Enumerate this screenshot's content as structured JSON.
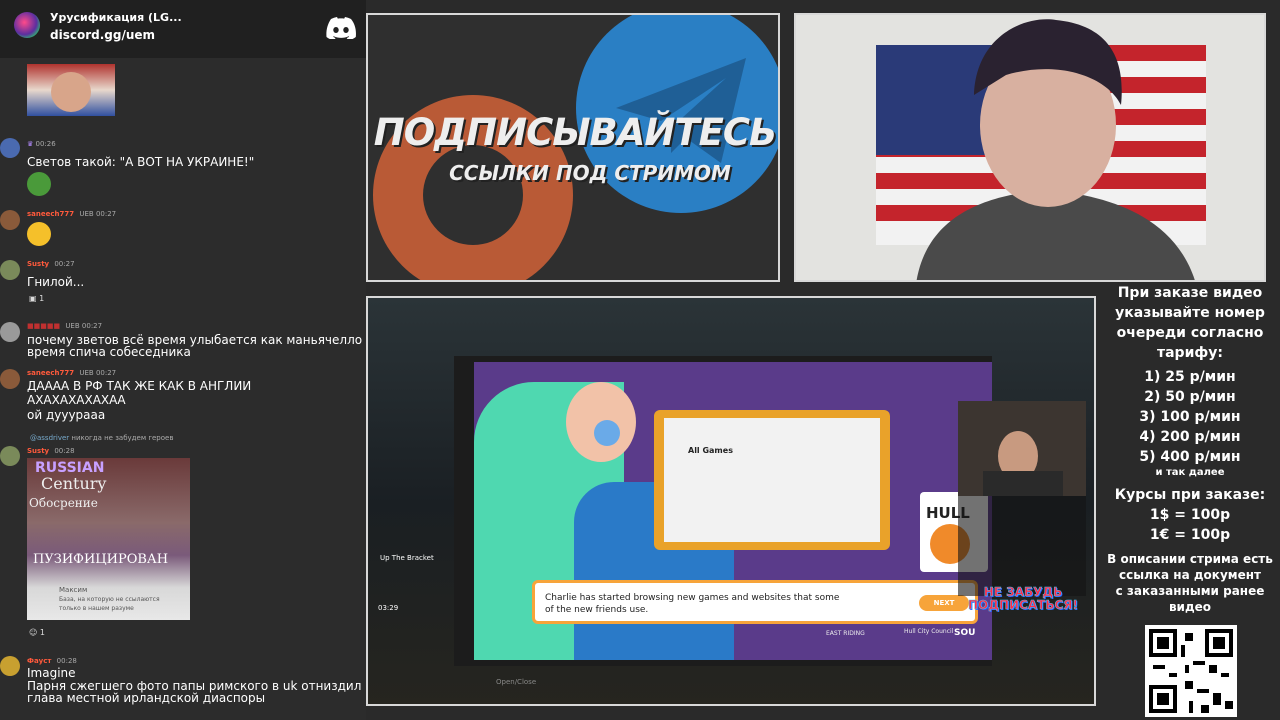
{
  "discord": {
    "server_name": "Урусификация (LG...",
    "link": "discord.gg/uem",
    "icon": "discord-icon"
  },
  "chat": {
    "messages": [
      {
        "time": "00:26",
        "text": "Светов такой: \"А ВОТ НА УКРАИНЕ!\""
      },
      {
        "user": "saneech777",
        "badge": "UEB",
        "time": "00:27"
      },
      {
        "user": "Susty",
        "time": "00:27",
        "text": "Гнилой...",
        "reaction_count": "1"
      },
      {
        "badge": "UEB",
        "time": "00:27",
        "text": "почему зветов всё время улыбается как маньячелло во",
        "text2": "время спича собеседника"
      },
      {
        "user": "saneech777",
        "badge": "UEB",
        "time": "00:27",
        "text": "ДАААА В РФ ТАК ЖЕ КАК В АНГЛИИ",
        "text2": "АХАХАХАХАХАА",
        "text3": "ой дууурааа"
      },
      {
        "reply_user": "@assdriver",
        "reply_text": "никогда не забудем героев"
      },
      {
        "user": "Susty",
        "time": "00:28",
        "image_lines": [
          "RUSSIAN",
          "Century",
          "Обосрение",
          "ПУЗИФИЦИРОВАН",
          "Максим",
          "База, на которую не ссылаются",
          "только в нашем разуме"
        ],
        "reaction_count": "1"
      },
      {
        "user": "Фауст",
        "time": "00:28",
        "text": "Imagine",
        "text2": "Парня сжегшего фото папы римского в uk отниздил",
        "text3": "глава местной ирландской диаспоры"
      }
    ]
  },
  "promo": {
    "title": "ПОДПИСЫВАЙТЕСЬ",
    "subtitle": "ССЫЛКИ ПОД СТРИМОМ"
  },
  "game": {
    "caption": "Charlie has started browsing new games and websites that some of the new friends use.",
    "next_label": "NEXT",
    "all_games": "All Games",
    "hull_logo": "HULL",
    "east_riding": "EAST RIDING",
    "hull_cc": "Hull City Council",
    "soun": "SOU",
    "up_bracket": "Up The Bracket",
    "time": "03:29",
    "open_close": "Open/Close",
    "ne_zabud": "НЕ ЗАБУДЬ ПОДПИСАТЬСЯ!"
  },
  "info": {
    "header": [
      "При заказе видео",
      "указывайте номер",
      "очереди согласно",
      "тарифу:"
    ],
    "tariffs": [
      "1) 25 р/мин",
      "2) 50 р/мин",
      "3) 100 р/мин",
      "4) 200 р/мин",
      "5) 400 р/мин"
    ],
    "etc": "и так далее",
    "rates_title": "Курсы при заказе:",
    "rates": [
      "1$ = 100р",
      "1€ = 100р"
    ],
    "doc_note": [
      "В описании стрима есть",
      "ссылка на документ",
      "с заказанными ранее",
      "видео"
    ]
  }
}
